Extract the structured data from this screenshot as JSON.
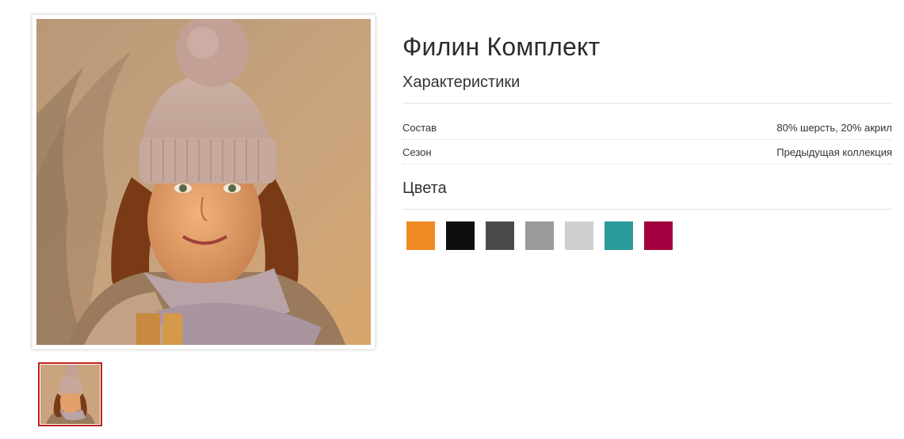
{
  "product": {
    "title": "Филин Комплект",
    "image_alt": "Woman wearing a knit pom-pom hat and scarf",
    "thumbnail_alt": "Thumbnail of product photo"
  },
  "characteristics": {
    "heading": "Характеристики",
    "rows": [
      {
        "label": "Состав",
        "value": "80% шерсть, 20% акрил"
      },
      {
        "label": "Сезон",
        "value": "Предыдущая коллекция"
      }
    ]
  },
  "colors": {
    "heading": "Цвета",
    "swatches": [
      {
        "name": "orange",
        "hex": "#f08a24"
      },
      {
        "name": "black",
        "hex": "#0e0e0e"
      },
      {
        "name": "dark-gray",
        "hex": "#4a4a4a"
      },
      {
        "name": "gray",
        "hex": "#9a9a9a"
      },
      {
        "name": "light-gray",
        "hex": "#cfcfcf"
      },
      {
        "name": "teal",
        "hex": "#2a9a9a"
      },
      {
        "name": "crimson",
        "hex": "#a3003f"
      }
    ]
  }
}
